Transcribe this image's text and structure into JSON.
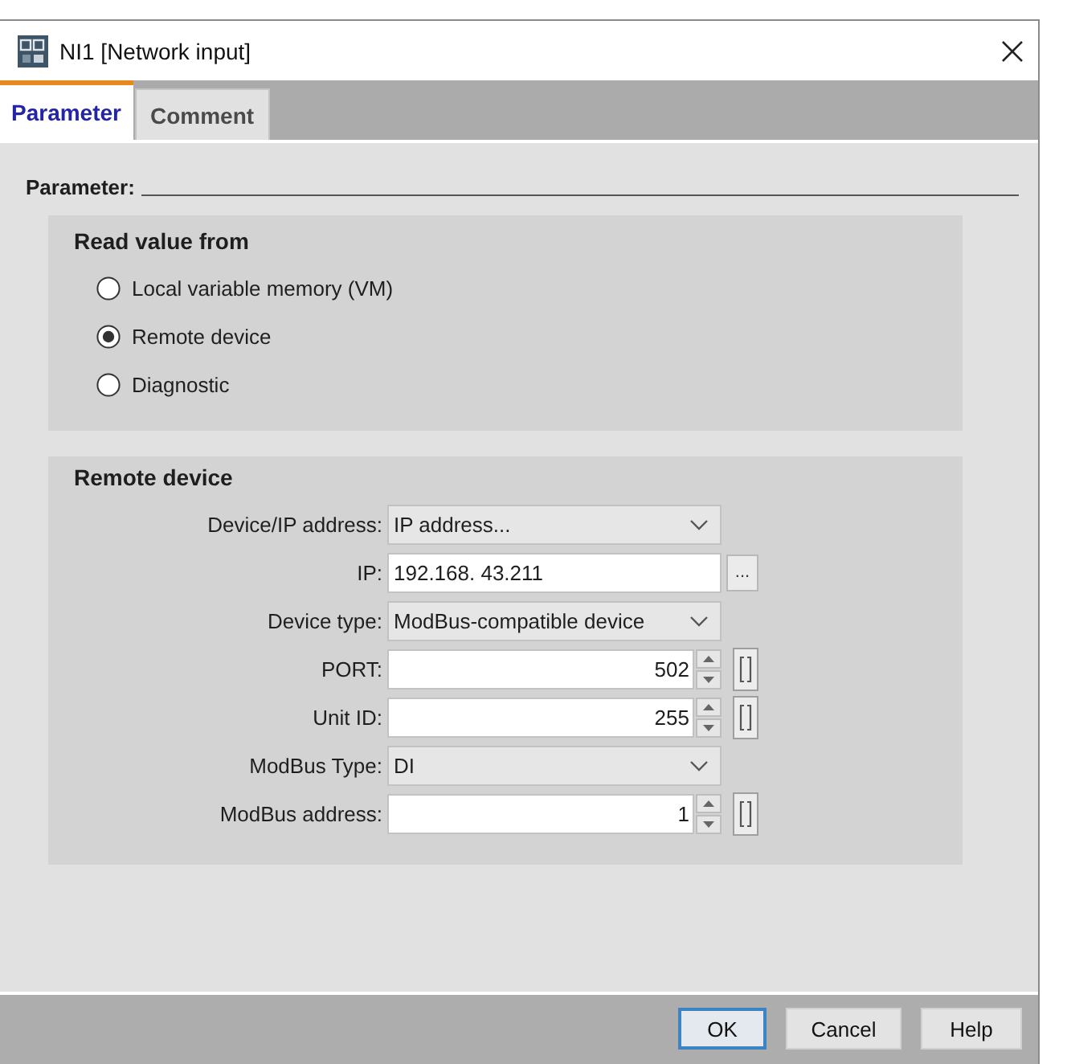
{
  "window": {
    "title": "NI1 [Network input]"
  },
  "tabs": [
    {
      "label": "Parameter",
      "selected": true
    },
    {
      "label": "Comment",
      "selected": false
    }
  ],
  "section_title": "Parameter:",
  "read_value_from": {
    "title": "Read value from",
    "options": [
      {
        "label": "Local variable memory (VM)",
        "selected": false
      },
      {
        "label": "Remote device",
        "selected": true
      },
      {
        "label": "Diagnostic",
        "selected": false
      }
    ]
  },
  "remote_device": {
    "title": "Remote device",
    "fields": [
      {
        "kind": "dropdown",
        "label": "Device/IP address:",
        "value": "IP address..."
      },
      {
        "kind": "text_button",
        "label": "IP:",
        "value": "192.168. 43.211",
        "button": "..."
      },
      {
        "kind": "dropdown",
        "label": "Device type:",
        "value": "ModBus-compatible device"
      },
      {
        "kind": "spinner",
        "label": "PORT:",
        "value": "502"
      },
      {
        "kind": "spinner",
        "label": "Unit ID:",
        "value": "255"
      },
      {
        "kind": "dropdown",
        "label": "ModBus Type:",
        "value": "DI"
      },
      {
        "kind": "spinner",
        "label": "ModBus address:",
        "value": "1"
      }
    ]
  },
  "buttons": [
    {
      "label": "OK",
      "default": true
    },
    {
      "label": "Cancel",
      "default": false
    },
    {
      "label": "Help",
      "default": false
    }
  ]
}
